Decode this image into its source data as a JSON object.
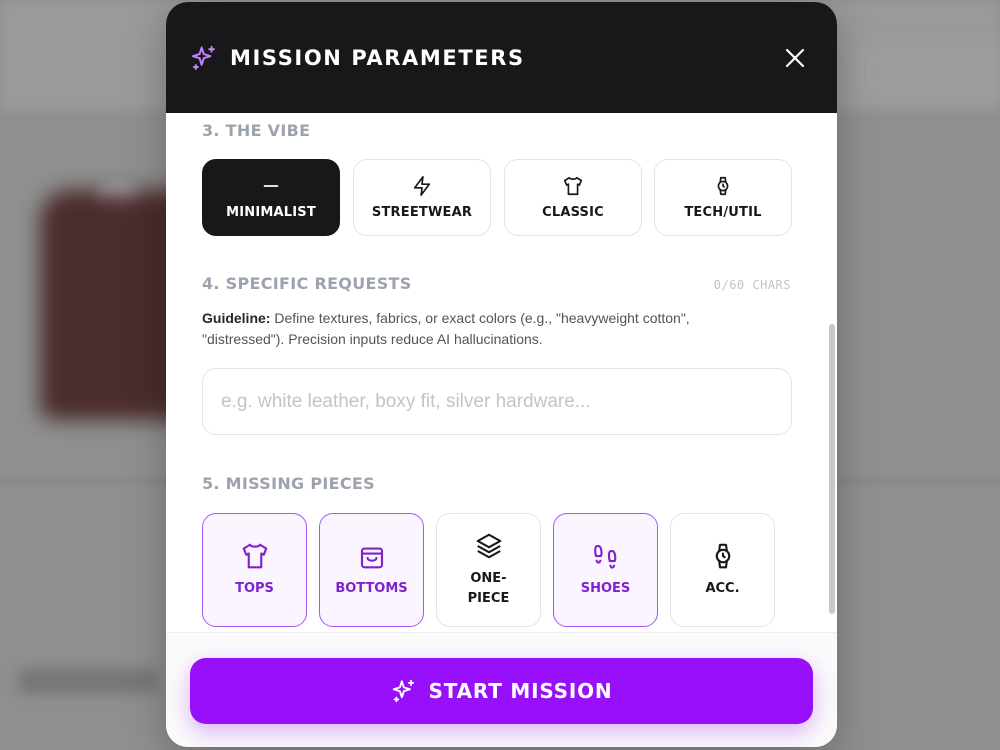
{
  "header": {
    "title": "MISSION PARAMETERS",
    "icon": "sparkles-icon",
    "close_icon": "close-icon"
  },
  "vibe": {
    "label": "3. THE VIBE",
    "options": [
      {
        "label": "MINIMALIST",
        "icon": "minus-icon",
        "selected": true
      },
      {
        "label": "STREETWEAR",
        "icon": "lightning-icon",
        "selected": false
      },
      {
        "label": "CLASSIC",
        "icon": "shirt-icon",
        "selected": false
      },
      {
        "label": "TECH/UTIL",
        "icon": "watch-icon",
        "selected": false
      }
    ]
  },
  "requests": {
    "label": "4. SPECIFIC REQUESTS",
    "char_count": "0/60 CHARS",
    "guideline_label": "Guideline:",
    "guideline_text": " Define textures, fabrics, or exact colors (e.g., \"heavyweight cotton\", \"distressed\"). Precision inputs reduce AI hallucinations.",
    "input_value": "",
    "input_placeholder": "e.g. white leather, boxy fit, silver hardware..."
  },
  "missing": {
    "label": "5. MISSING PIECES",
    "options": [
      {
        "label": "TOPS",
        "icon": "shirt-icon",
        "selected": true
      },
      {
        "label": "BOTTOMS",
        "icon": "bag-icon",
        "selected": true
      },
      {
        "label": "ONE-\nPIECE",
        "icon": "layers-icon",
        "selected": false
      },
      {
        "label": "SHOES",
        "icon": "footprints-icon",
        "selected": true
      },
      {
        "label": "ACC.",
        "icon": "watch-icon",
        "selected": false
      }
    ]
  },
  "footer": {
    "start_label": "START MISSION",
    "start_icon": "sparkles-icon"
  },
  "colors": {
    "accent": "#9810fa",
    "accent_light": "#a855f7",
    "selected_text": "#7e22ce",
    "dark": "#18181b"
  }
}
